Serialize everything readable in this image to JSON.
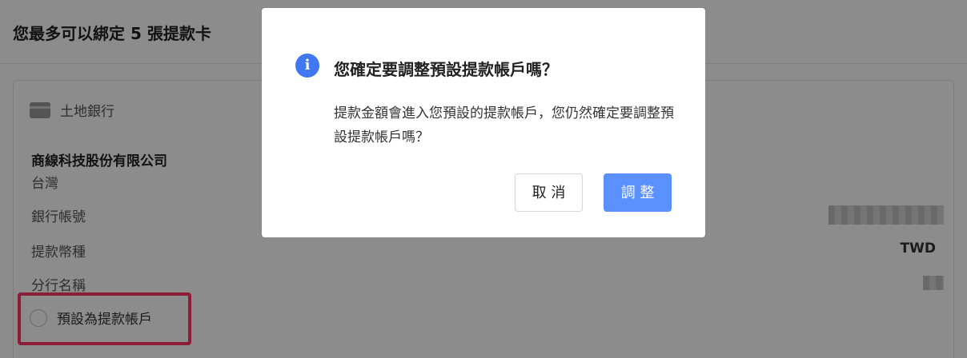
{
  "header": {
    "title": "您最多可以綁定 5 張提款卡"
  },
  "card": {
    "bank_name": "土地銀行",
    "company": "商線科技股份有限公司",
    "country": "台灣",
    "labels": {
      "account": "銀行帳號",
      "currency": "提款幣種",
      "branch": "分行名稱"
    },
    "currency_value": "TWD",
    "default_label": "預設為提款帳戶"
  },
  "modal": {
    "icon": "i",
    "title": "您確定要調整預設提款帳戶嗎？",
    "body": "提款金額會進入您預設的提款帳戶，您仍然確定要調整預設提款帳戶嗎？",
    "cancel_label": "取 消",
    "confirm_label": "調 整"
  },
  "colors": {
    "accent": "#5a90ff",
    "info_icon": "#3f78f0",
    "highlight": "#ff3366",
    "overlay": "rgba(0,0,0,0.45)"
  }
}
